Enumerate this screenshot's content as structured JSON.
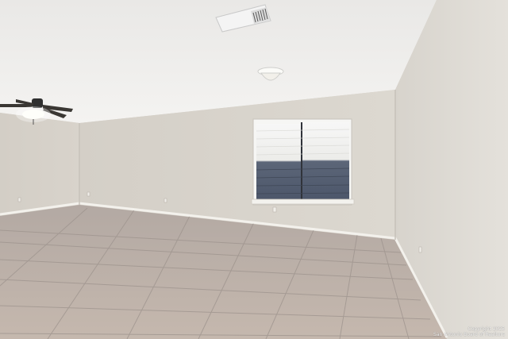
{
  "photo": {
    "watermark": {
      "line1": "Copyright 2025",
      "line2": "San Antonio Board of Realtors"
    }
  }
}
